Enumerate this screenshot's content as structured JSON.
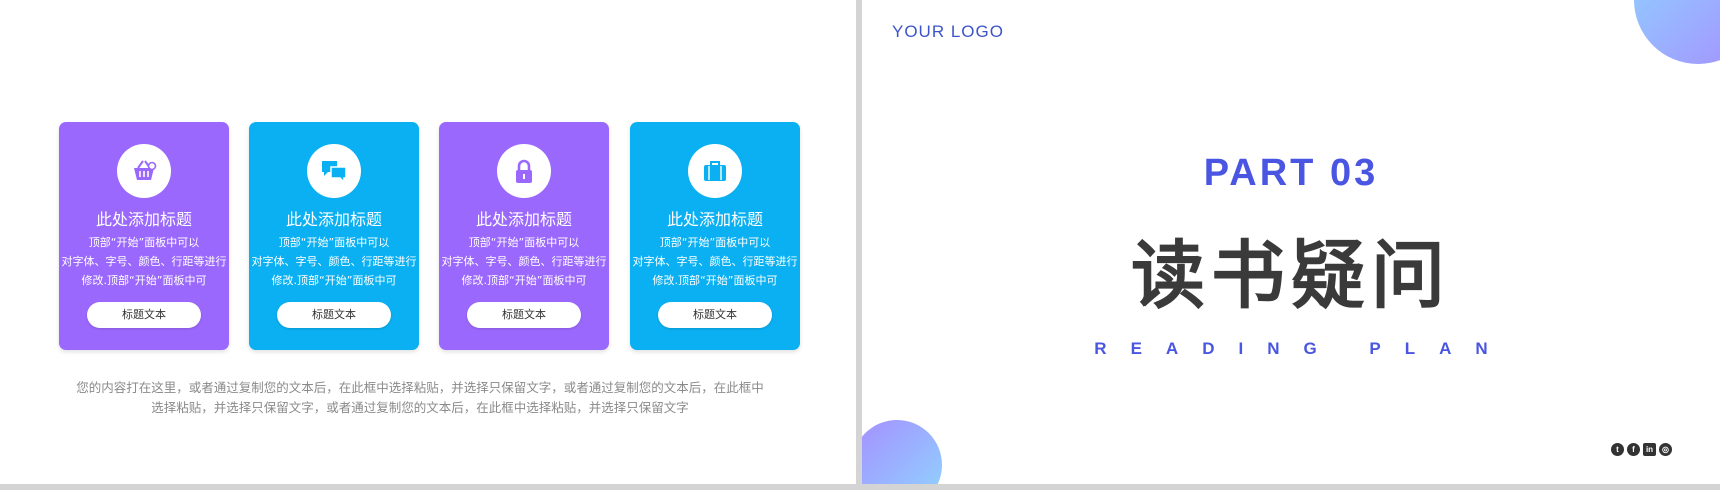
{
  "left_slide": {
    "cards": [
      {
        "title": "此处添加标题",
        "desc": [
          "顶部“开始”面板中可以",
          "对字体、字号、颜色、行距等进行",
          "修改.顶部“开始”面板中可"
        ],
        "button": "标题文本",
        "icon": "shopping-basket-icon",
        "color": "#9b68fd"
      },
      {
        "title": "此处添加标题",
        "desc": [
          "顶部“开始”面板中可以",
          "对字体、字号、颜色、行距等进行",
          "修改.顶部“开始”面板中可"
        ],
        "button": "标题文本",
        "icon": "chat-bubbles-icon",
        "color": "#0ab0f2"
      },
      {
        "title": "此处添加标题",
        "desc": [
          "顶部“开始”面板中可以",
          "对字体、字号、颜色、行距等进行",
          "修改.顶部“开始”面板中可"
        ],
        "button": "标题文本",
        "icon": "lock-icon",
        "color": "#9b68fd"
      },
      {
        "title": "此处添加标题",
        "desc": [
          "顶部“开始”面板中可以",
          "对字体、字号、颜色、行距等进行",
          "修改.顶部“开始”面板中可"
        ],
        "button": "标题文本",
        "icon": "briefcase-icon",
        "color": "#0ab0f2"
      }
    ],
    "body_text": [
      "您的内容打在这里，或者通过复制您的文本后，在此框中选择粘贴，并选择只保留文字，或者通过复制您的文本后，在此框中",
      "选择粘贴，并选择只保留文字，或者通过复制您的文本后，在此框中选择粘贴，并选择只保留文字"
    ]
  },
  "right_slide": {
    "logo": "YOUR  LOGO",
    "part": "PART  03",
    "title": "读书疑问",
    "subtitle": "READING  PLAN",
    "social_icons": [
      "twitter-icon",
      "facebook-icon",
      "linkedin-icon",
      "instagram-icon"
    ]
  }
}
